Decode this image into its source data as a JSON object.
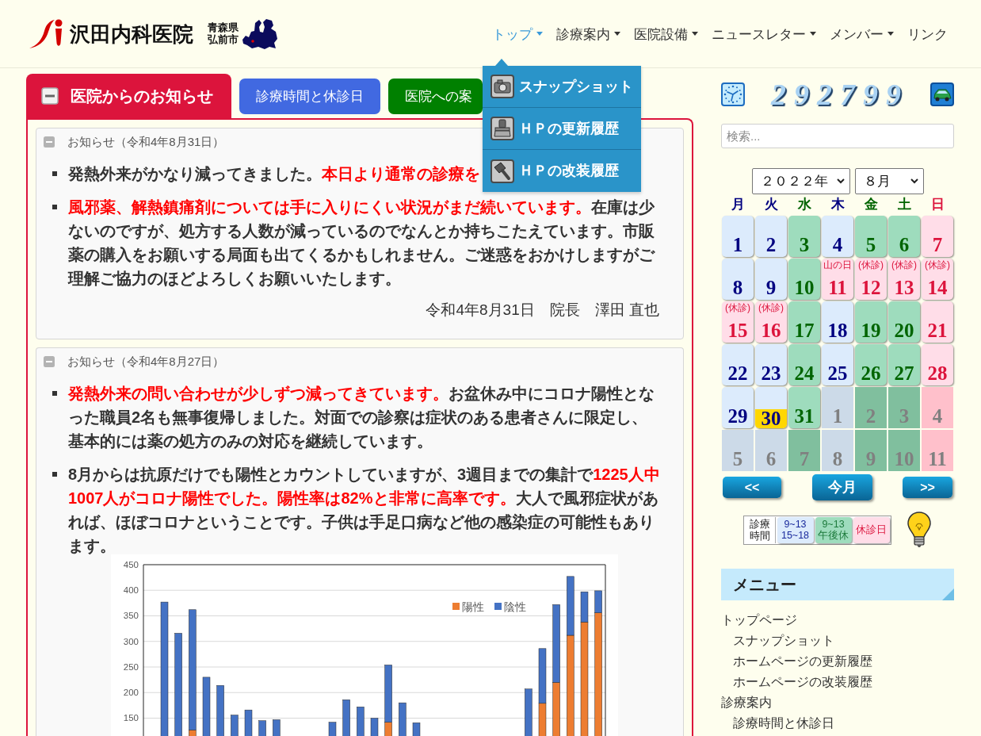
{
  "header": {
    "logo": {
      "name": "沢田内科医院",
      "prefecture": "青森県",
      "city": "弘前市"
    },
    "nav": [
      {
        "label": "トップ",
        "selected": true,
        "has_menu": true
      },
      {
        "label": "診療案内",
        "selected": false,
        "has_menu": true
      },
      {
        "label": "医院設備",
        "selected": false,
        "has_menu": true
      },
      {
        "label": "ニュースレター",
        "selected": false,
        "has_menu": true
      },
      {
        "label": "メンバー",
        "selected": false,
        "has_menu": true
      },
      {
        "label": "リンク",
        "selected": false,
        "has_menu": false
      }
    ],
    "dropdown": [
      {
        "label": "スナップショット"
      },
      {
        "label": "ＨＰの更新履歴"
      },
      {
        "label": "ＨＰの改装履歴"
      }
    ]
  },
  "main": {
    "tabs": [
      {
        "label": "医院からのお知らせ",
        "selected": true,
        "color": "#dc143c"
      },
      {
        "label": "診療時間と休診日",
        "selected": false,
        "color": "#4169e1"
      },
      {
        "label": "医院への案",
        "selected": false,
        "color": "#008000"
      }
    ],
    "notices": [
      {
        "title": "お知らせ（令和4年8月31日）",
        "items": [
          {
            "segments": [
              {
                "text": "発熱外来がかなり減ってきました。",
                "highlighted": false
              },
              {
                "text": "本日より通常の診療を",
                "highlighted": true
              }
            ]
          },
          {
            "segments": [
              {
                "text": "風邪薬、解熱鎮痛剤については手に入りにくい状況がまだ続いています。",
                "highlighted": true
              },
              {
                "text": "在庫は少ないのですが、処方する人数が減っているのでなんとか持ちこたえています。市販薬の購入をお願いする局面も出てくるかもしれません。ご迷惑をおかけしますがご理解ご協力のほどよろしくお願いいたします。",
                "highlighted": false
              }
            ]
          }
        ],
        "signature": "令和4年8月31日　院長　澤田 直也"
      },
      {
        "title": "お知らせ（令和4年8月27日）",
        "items": [
          {
            "segments": [
              {
                "text": "発熱外来の問い合わせが少しずつ減ってきています。",
                "highlighted": true
              },
              {
                "text": "お盆休み中にコロナ陽性となった職員2名も無事復帰しました。対面での診察は症状のある患者さんに限定し、基本的には薬の処方のみの対応を継続しています。",
                "highlighted": false
              }
            ]
          },
          {
            "segments": [
              {
                "text": "8月からは抗原だけでも陽性とカウントしていますが、3週目までの集計で",
                "highlighted": false
              },
              {
                "text": "1225人中1007人がコロナ陽性でした。陽性率は82%と非常に高率です。",
                "highlighted": true
              },
              {
                "text": "大人で風邪症状があれば、ほぼコロナということです。子供は手足口病など他の感染症の可能性もあります。",
                "highlighted": false
              }
            ],
            "chart_data": {
              "type": "bar",
              "stacked": true,
              "grid": true,
              "legend": "upper right",
              "ylim": [
                0,
                450
              ],
              "yticks": [
                150,
                200,
                250,
                300,
                350,
                400,
                450
              ],
              "series": [
                {
                  "name": "陽性",
                  "color": "#ed7d31",
                  "values": [
                    null,
                    null,
                    null,
                    127,
                    null,
                    null,
                    null,
                    null,
                    null,
                    null,
                    null,
                    null,
                    null,
                    null,
                    null,
                    null,
                    null,
                    142,
                    null,
                    null,
                    null,
                    null,
                    null,
                    null,
                    null,
                    null,
                    null,
                    null,
                    179,
                    220,
                    312,
                    338,
                    356
                  ]
                },
                {
                  "name": "陰性",
                  "color": "#4472c4",
                  "values": [
                    null,
                    377,
                    316,
                    235,
                    230,
                    214,
                    156,
                    166,
                    145,
                    147,
                    null,
                    null,
                    null,
                    142,
                    186,
                    172,
                    150,
                    112,
                    180,
                    141,
                    null,
                    null,
                    null,
                    null,
                    null,
                    null,
                    null,
                    207,
                    107,
                    152,
                    115,
                    59,
                    43
                  ]
                }
              ]
            }
          }
        ]
      }
    ]
  },
  "sidebar": {
    "counter": "292799",
    "search": {
      "placeholder": "検索..."
    },
    "calendar": {
      "year": "２０２２年",
      "month": "８月",
      "weekdays": [
        {
          "label": "月",
          "kind": "open"
        },
        {
          "label": "火",
          "kind": "open"
        },
        {
          "label": "水",
          "kind": "afternoon_off"
        },
        {
          "label": "木",
          "kind": "open"
        },
        {
          "label": "金",
          "kind": "afternoon_off"
        },
        {
          "label": "土",
          "kind": "afternoon_off"
        },
        {
          "label": "日",
          "kind": "closed"
        }
      ],
      "weeks": [
        [
          {
            "label": "1",
            "kind": "open",
            "other_month": false,
            "today": false
          },
          {
            "label": "2",
            "kind": "open",
            "other_month": false,
            "today": false
          },
          {
            "label": "3",
            "kind": "afternoon_off",
            "other_month": false,
            "today": false
          },
          {
            "label": "4",
            "kind": "open",
            "other_month": false,
            "today": false
          },
          {
            "label": "5",
            "kind": "afternoon_off",
            "other_month": false,
            "today": false
          },
          {
            "label": "6",
            "kind": "afternoon_off",
            "other_month": false,
            "today": false
          },
          {
            "label": "7",
            "kind": "closed",
            "other_month": false,
            "today": false
          }
        ],
        [
          {
            "label": "8",
            "kind": "open",
            "other_month": false,
            "today": false
          },
          {
            "label": "9",
            "kind": "open",
            "other_month": false,
            "today": false
          },
          {
            "label": "10",
            "kind": "afternoon_off",
            "other_month": false,
            "today": false
          },
          {
            "label": "11",
            "kind": "closed",
            "note": "山の日",
            "other_month": false,
            "today": false
          },
          {
            "label": "12",
            "kind": "closed",
            "note": "(休診)",
            "other_month": false,
            "today": false
          },
          {
            "label": "13",
            "kind": "closed",
            "note": "(休診)",
            "other_month": false,
            "today": false
          },
          {
            "label": "14",
            "kind": "closed",
            "note": "(休診)",
            "other_month": false,
            "today": false
          }
        ],
        [
          {
            "label": "15",
            "kind": "closed",
            "note": "(休診)",
            "other_month": false,
            "today": false
          },
          {
            "label": "16",
            "kind": "closed",
            "note": "(休診)",
            "other_month": false,
            "today": false
          },
          {
            "label": "17",
            "kind": "afternoon_off",
            "other_month": false,
            "today": false
          },
          {
            "label": "18",
            "kind": "open",
            "other_month": false,
            "today": false
          },
          {
            "label": "19",
            "kind": "afternoon_off",
            "other_month": false,
            "today": false
          },
          {
            "label": "20",
            "kind": "afternoon_off",
            "other_month": false,
            "today": false
          },
          {
            "label": "21",
            "kind": "closed",
            "other_month": false,
            "today": false
          }
        ],
        [
          {
            "label": "22",
            "kind": "open",
            "other_month": false,
            "today": false
          },
          {
            "label": "23",
            "kind": "open",
            "other_month": false,
            "today": false
          },
          {
            "label": "24",
            "kind": "afternoon_off",
            "other_month": false,
            "today": false
          },
          {
            "label": "25",
            "kind": "open",
            "other_month": false,
            "today": false
          },
          {
            "label": "26",
            "kind": "afternoon_off",
            "other_month": false,
            "today": false
          },
          {
            "label": "27",
            "kind": "afternoon_off",
            "other_month": false,
            "today": false
          },
          {
            "label": "28",
            "kind": "closed",
            "other_month": false,
            "today": false
          }
        ],
        [
          {
            "label": "29",
            "kind": "open",
            "other_month": false,
            "today": false
          },
          {
            "label": "30",
            "kind": "open",
            "other_month": false,
            "today": true
          },
          {
            "label": "31",
            "kind": "afternoon_off",
            "other_month": false,
            "today": false
          },
          {
            "label": "1",
            "kind": "open",
            "other_month": true,
            "today": false
          },
          {
            "label": "2",
            "kind": "afternoon_off",
            "other_month": true,
            "today": false
          },
          {
            "label": "3",
            "kind": "afternoon_off",
            "other_month": true,
            "today": false
          },
          {
            "label": "4",
            "kind": "closed",
            "other_month": true,
            "today": false
          }
        ],
        [
          {
            "label": "5",
            "kind": "open",
            "other_month": true,
            "today": false
          },
          {
            "label": "6",
            "kind": "open",
            "other_month": true,
            "today": false
          },
          {
            "label": "7",
            "kind": "afternoon_off",
            "other_month": true,
            "today": false
          },
          {
            "label": "8",
            "kind": "open",
            "other_month": true,
            "today": false
          },
          {
            "label": "9",
            "kind": "afternoon_off",
            "other_month": true,
            "today": false
          },
          {
            "label": "10",
            "kind": "afternoon_off",
            "other_month": true,
            "today": false
          },
          {
            "label": "11",
            "kind": "closed",
            "other_month": true,
            "today": false
          }
        ]
      ],
      "buttons": [
        {
          "label": "<<"
        },
        {
          "label": "今月"
        },
        {
          "label": ">>"
        }
      ],
      "legend": {
        "title": "診療時間",
        "items": [
          {
            "label": "9~13\n15~18",
            "kind": "open"
          },
          {
            "label": "9~13\n午後休",
            "kind": "afternoon_off"
          },
          {
            "label": "休診日",
            "kind": "closed"
          }
        ]
      }
    },
    "menu": {
      "title": "メニュー",
      "items": [
        {
          "label": "トップページ",
          "children": [
            {
              "label": "スナップショット"
            },
            {
              "label": "ホームページの更新履歴"
            },
            {
              "label": "ホームページの改装履歴"
            }
          ]
        },
        {
          "label": "診療案内",
          "children": [
            {
              "label": "診療時間と休診日"
            }
          ]
        }
      ]
    }
  }
}
